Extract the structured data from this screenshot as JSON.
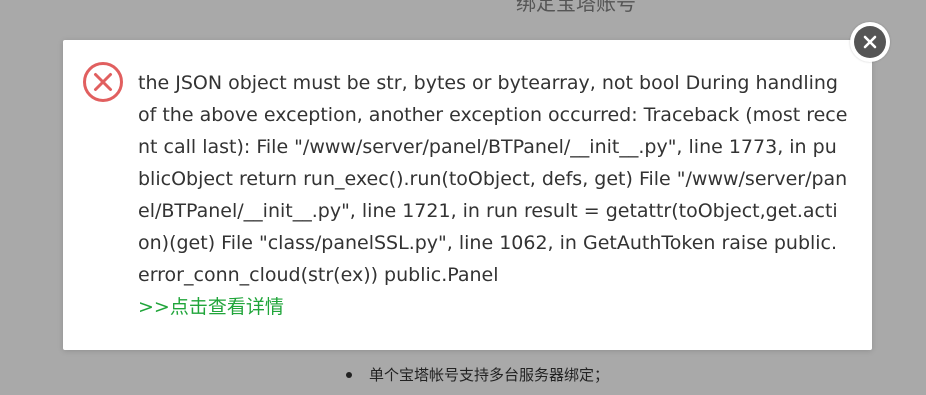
{
  "background": {
    "title": "绑定宝塔账号",
    "bullet_text": "单个宝塔帐号支持多台服务器绑定；"
  },
  "dialog": {
    "icon": "error-x-circle-icon",
    "icon_color": "#e15f5f",
    "message": "the JSON object must be str, bytes or bytearray, not bool During handling of the above exception, another exception occurred: Traceback (most recent call last): File \"/www/server/panel/BTPanel/__init__.py\", line 1773, in publicObject return run_exec().run(toObject, defs, get) File \"/www/server/panel/BTPanel/__init__.py\", line 1721, in run result = getattr(toObject,get.action)(get) File \"class/panelSSL.py\", line 1062, in GetAuthToken raise public.error_conn_cloud(str(ex)) public.Panel",
    "details_link": ">>点击查看详情",
    "link_color": "#20a53a",
    "close_icon": "close-icon"
  }
}
